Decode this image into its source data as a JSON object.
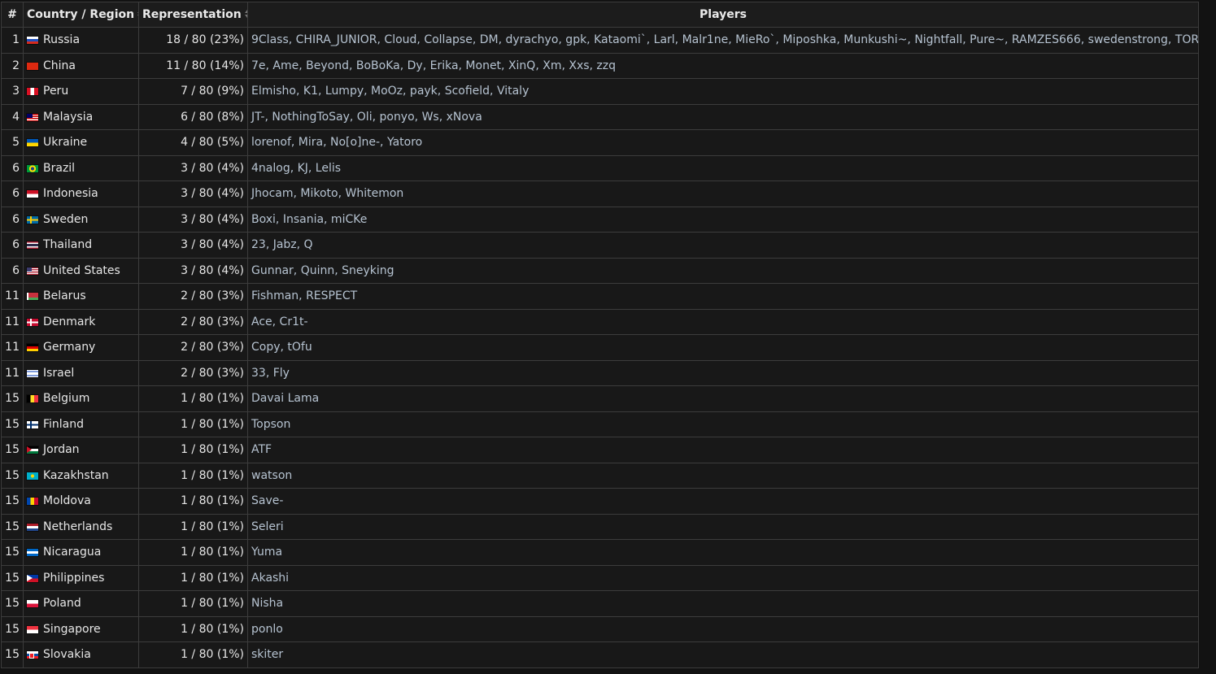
{
  "header": {
    "rank": "#",
    "country": "Country / Region",
    "representation": "Representation",
    "players": "Players"
  },
  "rows": [
    {
      "rank": "1",
      "country": "Russia",
      "flag": "russia-flag-icon",
      "rep": "18 / 80 (23%)",
      "players": "9Class, CHIRA_JUNIOR, Cloud, Collapse, DM, dyrachyo, gpk, Kataomi`, Larl, Malr1ne, MieRo`, Miposhka, Munkushi~, Nightfall, Pure~, RAMZES666, swedenstrong, TORONTOTOKYO"
    },
    {
      "rank": "2",
      "country": "China",
      "flag": "china-flag-icon",
      "rep": "11 / 80 (14%)",
      "players": "7e, Ame, Beyond, BoBoKa, Dy, Erika, Monet, XinQ, Xm, Xxs, zzq"
    },
    {
      "rank": "3",
      "country": "Peru",
      "flag": "peru-flag-icon",
      "rep": "7 / 80 (9%)",
      "players": "Elmisho, K1, Lumpy, MoOz, payk, Scofield, Vitaly"
    },
    {
      "rank": "4",
      "country": "Malaysia",
      "flag": "malaysia-flag-icon",
      "rep": "6 / 80 (8%)",
      "players": "JT-, NothingToSay, Oli, ponyo, Ws, xNova"
    },
    {
      "rank": "5",
      "country": "Ukraine",
      "flag": "ukraine-flag-icon",
      "rep": "4 / 80 (5%)",
      "players": "lorenof, Mira, No[o]ne-, Yatoro"
    },
    {
      "rank": "6",
      "country": "Brazil",
      "flag": "brazil-flag-icon",
      "rep": "3 / 80 (4%)",
      "players": "4nalog, KJ, Lelis"
    },
    {
      "rank": "6",
      "country": "Indonesia",
      "flag": "indonesia-flag-icon",
      "rep": "3 / 80 (4%)",
      "players": "Jhocam, Mikoto, Whitemon"
    },
    {
      "rank": "6",
      "country": "Sweden",
      "flag": "sweden-flag-icon",
      "rep": "3 / 80 (4%)",
      "players": "Boxi, Insania, miCKe"
    },
    {
      "rank": "6",
      "country": "Thailand",
      "flag": "thailand-flag-icon",
      "rep": "3 / 80 (4%)",
      "players": "23, Jabz, Q"
    },
    {
      "rank": "6",
      "country": "United States",
      "flag": "usa-flag-icon",
      "rep": "3 / 80 (4%)",
      "players": "Gunnar, Quinn, Sneyking"
    },
    {
      "rank": "11",
      "country": "Belarus",
      "flag": "belarus-flag-icon",
      "rep": "2 / 80 (3%)",
      "players": "Fishman, RESPECT"
    },
    {
      "rank": "11",
      "country": "Denmark",
      "flag": "denmark-flag-icon",
      "rep": "2 / 80 (3%)",
      "players": "Ace, Cr1t-"
    },
    {
      "rank": "11",
      "country": "Germany",
      "flag": "germany-flag-icon",
      "rep": "2 / 80 (3%)",
      "players": "Copy, tOfu"
    },
    {
      "rank": "11",
      "country": "Israel",
      "flag": "israel-flag-icon",
      "rep": "2 / 80 (3%)",
      "players": "33, Fly"
    },
    {
      "rank": "15",
      "country": "Belgium",
      "flag": "belgium-flag-icon",
      "rep": "1 / 80 (1%)",
      "players": "Davai Lama"
    },
    {
      "rank": "15",
      "country": "Finland",
      "flag": "finland-flag-icon",
      "rep": "1 / 80 (1%)",
      "players": "Topson"
    },
    {
      "rank": "15",
      "country": "Jordan",
      "flag": "jordan-flag-icon",
      "rep": "1 / 80 (1%)",
      "players": "ATF"
    },
    {
      "rank": "15",
      "country": "Kazakhstan",
      "flag": "kazakhstan-flag-icon",
      "rep": "1 / 80 (1%)",
      "players": "watson"
    },
    {
      "rank": "15",
      "country": "Moldova",
      "flag": "moldova-flag-icon",
      "rep": "1 / 80 (1%)",
      "players": "Save-"
    },
    {
      "rank": "15",
      "country": "Netherlands",
      "flag": "netherlands-flag-icon",
      "rep": "1 / 80 (1%)",
      "players": "Seleri"
    },
    {
      "rank": "15",
      "country": "Nicaragua",
      "flag": "nicaragua-flag-icon",
      "rep": "1 / 80 (1%)",
      "players": "Yuma"
    },
    {
      "rank": "15",
      "country": "Philippines",
      "flag": "philippines-flag-icon",
      "rep": "1 / 80 (1%)",
      "players": "Akashi"
    },
    {
      "rank": "15",
      "country": "Poland",
      "flag": "poland-flag-icon",
      "rep": "1 / 80 (1%)",
      "players": "Nisha"
    },
    {
      "rank": "15",
      "country": "Singapore",
      "flag": "singapore-flag-icon",
      "rep": "1 / 80 (1%)",
      "players": "ponlo"
    },
    {
      "rank": "15",
      "country": "Slovakia",
      "flag": "slovakia-flag-icon",
      "rep": "1 / 80 (1%)",
      "players": "skiter"
    }
  ],
  "colors": {
    "background": "#121212",
    "header_bg": "#1c1c1c",
    "cell_bg": "#181818",
    "border": "#3c3c3c",
    "text": "#e6e6e6",
    "player_link": "#b6c3d1",
    "player_link_visited": "#8aa8c2"
  }
}
